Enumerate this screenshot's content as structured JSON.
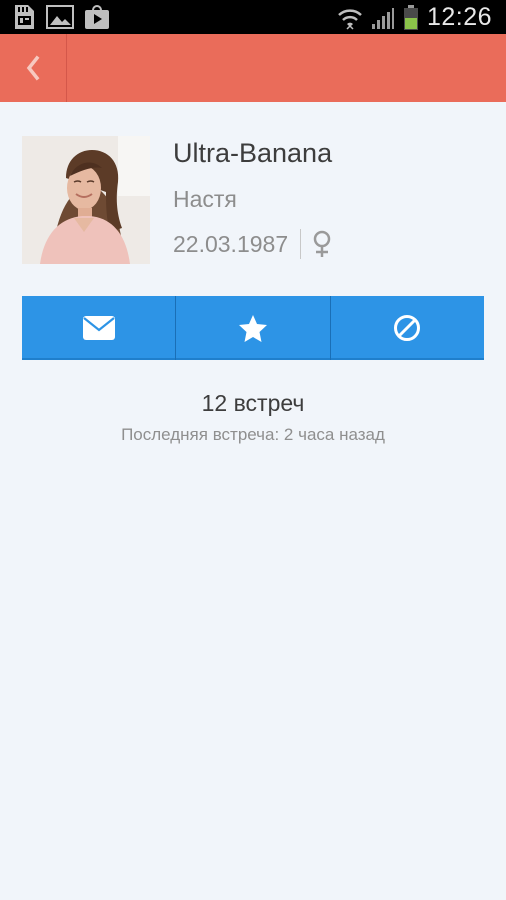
{
  "status_bar": {
    "time": "12:26",
    "left_icons": [
      "sd-card-icon",
      "gallery-icon",
      "play-store-icon"
    ],
    "right_icons": [
      "wifi-icon",
      "signal-icon",
      "battery-icon"
    ]
  },
  "app_bar": {
    "background": "#ea6c5a",
    "back_icon": "chevron-left-icon"
  },
  "profile": {
    "username": "Ultra-Banana",
    "real_name": "Настя",
    "birth_date": "22.03.1987",
    "gender_icon": "female-icon"
  },
  "actions": [
    {
      "icon": "envelope-icon"
    },
    {
      "icon": "star-icon"
    },
    {
      "icon": "block-icon"
    }
  ],
  "stats": {
    "meetings_count": "12 встреч",
    "last_meeting": "Последняя встреча: 2 часа назад"
  },
  "colors": {
    "accent": "#ea6c5a",
    "action_blue": "#2d94e6",
    "background": "#f1f5fa"
  }
}
